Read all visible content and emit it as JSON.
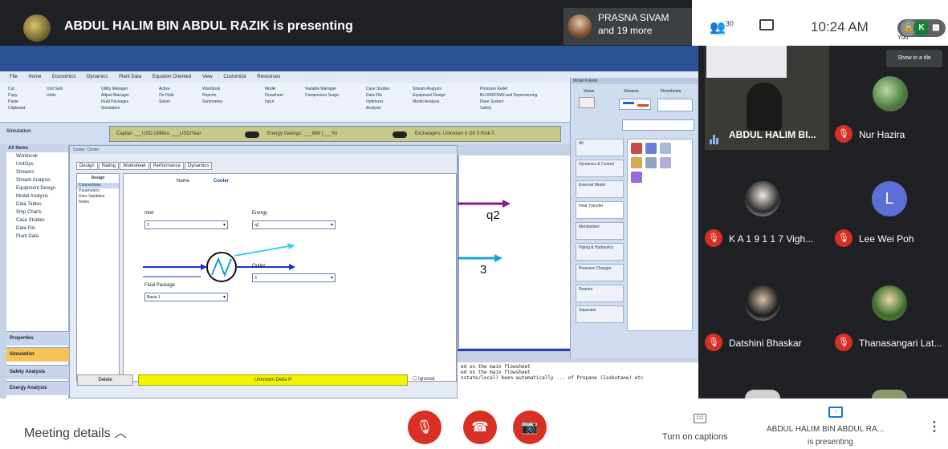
{
  "topbar": {
    "presenting_title": "ABDUL HALIM BIN ABDUL RAZIK is presenting",
    "sharing_names": [
      "PRASNA SIVAM",
      "and 19 more"
    ],
    "people_count": "30",
    "time": "10:24 AM",
    "self_initials": [
      "K"
    ],
    "you_label": "You",
    "show_in_tile": "Show in a tile"
  },
  "hysys": {
    "ribbon_tabs": [
      "File",
      "Home",
      "Economics",
      "Dynamics",
      "Plant Data",
      "Equation Oriented",
      "View",
      "Customize",
      "Resources"
    ],
    "ribbon_groups": [
      [
        "Cut",
        "Copy",
        "Paste",
        "Clipboard"
      ],
      [
        "Unit Sets",
        "Units"
      ],
      [
        "Utility Manager",
        "Adjust Manager",
        "Fluid Packages",
        "Simulation"
      ],
      [
        "Active",
        "On Hold",
        "Solver"
      ],
      [
        "Workbook",
        "Reports",
        "Summaries"
      ],
      [
        "Model",
        "Flowsheet",
        "Input"
      ],
      [
        "Variable Manager",
        "Compressor Surge"
      ],
      [
        "Case Studies",
        "Data Fits",
        "Optimizer",
        "Analysis"
      ],
      [
        "Stream Analysis",
        "Equipment Design",
        "Model Analysis"
      ],
      [
        "Pressure Relief",
        "BLOWDOWN and Depressuring",
        "Flare System",
        "Safety"
      ]
    ],
    "simulation_label": "Simulation",
    "yellow_bar": {
      "capital": "Capital: ___USD  Utilities: ___USD/Year",
      "energy": "Energy Savings: ___MW  (___%)",
      "exchangers": "Exchangers: Unknown 0  OK 0  Risk 0"
    },
    "nav_header": "All Items",
    "nav_items": [
      "Workbook",
      "UnitOps",
      "Streams",
      "Stream Analysis",
      "Equipment Design",
      "Model Analysis",
      "Data Tables",
      "Strip Charts",
      "Case Studies",
      "Data Fits",
      "Plant Data"
    ],
    "nav_buttons": [
      "Properties",
      "Simulation",
      "Safety Analysis",
      "Energy Analysis"
    ],
    "cooler": {
      "window_title": "Cooler: Cooler",
      "tabs": [
        "Design",
        "Rating",
        "Worksheet",
        "Performance",
        "Dynamics"
      ],
      "side_header": "Design",
      "side_items": [
        "Connections",
        "Parameters",
        "User Variables",
        "Notes"
      ],
      "name_label": "Name",
      "name_value": "Cooler",
      "inlet_label": "Inlet",
      "inlet_value": "2",
      "energy_label": "Energy",
      "energy_value": "q2",
      "outlet_label": "Outlet",
      "outlet_value": "3",
      "fluid_label": "Fluid Package",
      "fluid_value": "Basis-1",
      "delete_label": "Delete",
      "status_text": "Unknown Delta P",
      "ignored_label": "Ignored"
    },
    "pfd": {
      "q2_label": "q2",
      "stream3_label": "3"
    },
    "messages": [
      "ed on the main flowsheet",
      "ed on the main flowsheet",
      "nstate/local) been automatically ... of Propane (Isobutane) etc"
    ],
    "palette": {
      "title": "Model Palette",
      "views_label": "Views",
      "streams_label": "Streams",
      "flowsheets_label": "Flowsheets",
      "categories": [
        "All",
        "Dynamics & Control",
        "External Model",
        "Heat Transfer",
        "Manipulator",
        "Piping & Hydraulics",
        "Pressure Changer",
        "Reactor",
        "Separator"
      ]
    }
  },
  "participants": [
    {
      "name": "ABDUL HALIM BI...",
      "speaking": true
    },
    {
      "name": "Nur Hazira",
      "muted": true
    },
    {
      "name": "K A 1 9 1 1 7 Vigh...",
      "muted": true
    },
    {
      "name": "Lee Wei Poh",
      "muted": true,
      "initial": "L",
      "color": "#5b6fd6"
    },
    {
      "name": "Datshini Bhaskar",
      "muted": true
    },
    {
      "name": "Thanasangari Lat...",
      "muted": true
    }
  ],
  "bottom": {
    "meeting_details": "Meeting details",
    "captions_label": "Turn on captions",
    "presenting_line1": "ABDUL HALIM BIN ABDUL RA...",
    "presenting_line2": "is presenting"
  },
  "colors": {
    "meet_dark": "#202124",
    "danger_red": "#d93025",
    "accent_blue": "#1a73e8"
  }
}
